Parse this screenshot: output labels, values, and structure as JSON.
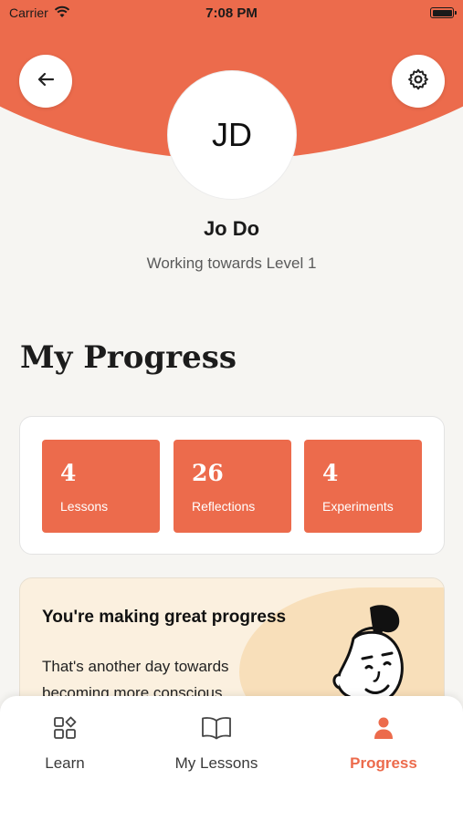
{
  "status_bar": {
    "carrier": "Carrier",
    "time": "7:08 PM"
  },
  "header": {
    "back_icon": "arrow-left-icon",
    "settings_icon": "gear-icon",
    "accent_color": "#ec6b4c"
  },
  "profile": {
    "initials": "JD",
    "name": "Jo Do",
    "subtitle": "Working towards Level 1"
  },
  "progress": {
    "title": "My Progress",
    "stats": [
      {
        "value": "4",
        "label": "Lessons"
      },
      {
        "value": "26",
        "label": "Reflections"
      },
      {
        "value": "4",
        "label": "Experiments"
      }
    ]
  },
  "promo": {
    "title": "You're making great progress",
    "text": "That's another day towards becoming more conscious."
  },
  "tabs": [
    {
      "label": "Learn",
      "icon": "grid-shapes-icon",
      "active": false
    },
    {
      "label": "My Lessons",
      "icon": "open-book-icon",
      "active": false
    },
    {
      "label": "Progress",
      "icon": "person-icon",
      "active": true
    }
  ]
}
